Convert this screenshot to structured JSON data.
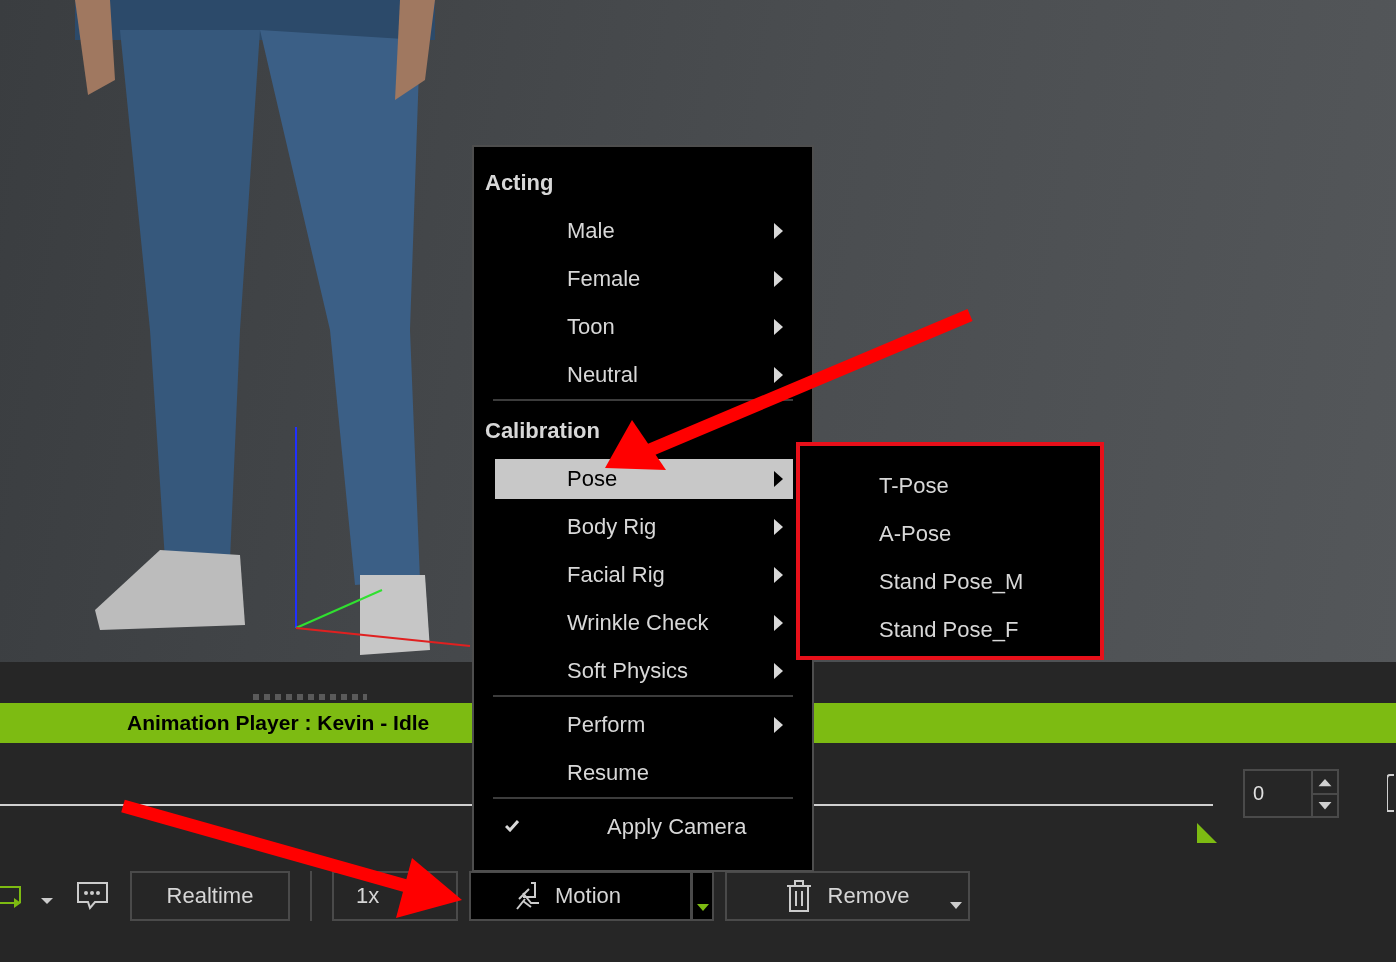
{
  "menu": {
    "sections": [
      {
        "title": "Acting",
        "items": [
          {
            "label": "Male",
            "kind": "submenu",
            "selected": false
          },
          {
            "label": "Female",
            "kind": "submenu",
            "selected": false
          },
          {
            "label": "Toon",
            "kind": "submenu",
            "selected": false
          },
          {
            "label": "Neutral",
            "kind": "submenu",
            "selected": false
          }
        ]
      },
      {
        "title": "Calibration",
        "items": [
          {
            "label": "Pose",
            "kind": "submenu",
            "selected": true
          },
          {
            "label": "Body Rig",
            "kind": "submenu",
            "selected": false
          },
          {
            "label": "Facial Rig",
            "kind": "submenu",
            "selected": false
          },
          {
            "label": "Wrinkle Check",
            "kind": "submenu",
            "selected": false
          },
          {
            "label": "Soft Physics",
            "kind": "submenu",
            "selected": false
          }
        ]
      },
      {
        "items": [
          {
            "label": "Perform",
            "kind": "submenu",
            "selected": false
          },
          {
            "label": "Resume",
            "kind": "action",
            "selected": false
          }
        ]
      },
      {
        "items": [
          {
            "label": "Apply Camera",
            "kind": "check",
            "checked": true,
            "selected": false
          }
        ]
      }
    ]
  },
  "submenu": {
    "items": [
      "T-Pose",
      "A-Pose",
      "Stand Pose_M",
      "Stand Pose_F"
    ]
  },
  "animation_player": {
    "title": "Animation Player : Kevin - Idle"
  },
  "frame_field": {
    "value": "0"
  },
  "toolbar": {
    "realtime": "Realtime",
    "speed": "1x",
    "motion": "Motion",
    "remove": "Remove"
  }
}
